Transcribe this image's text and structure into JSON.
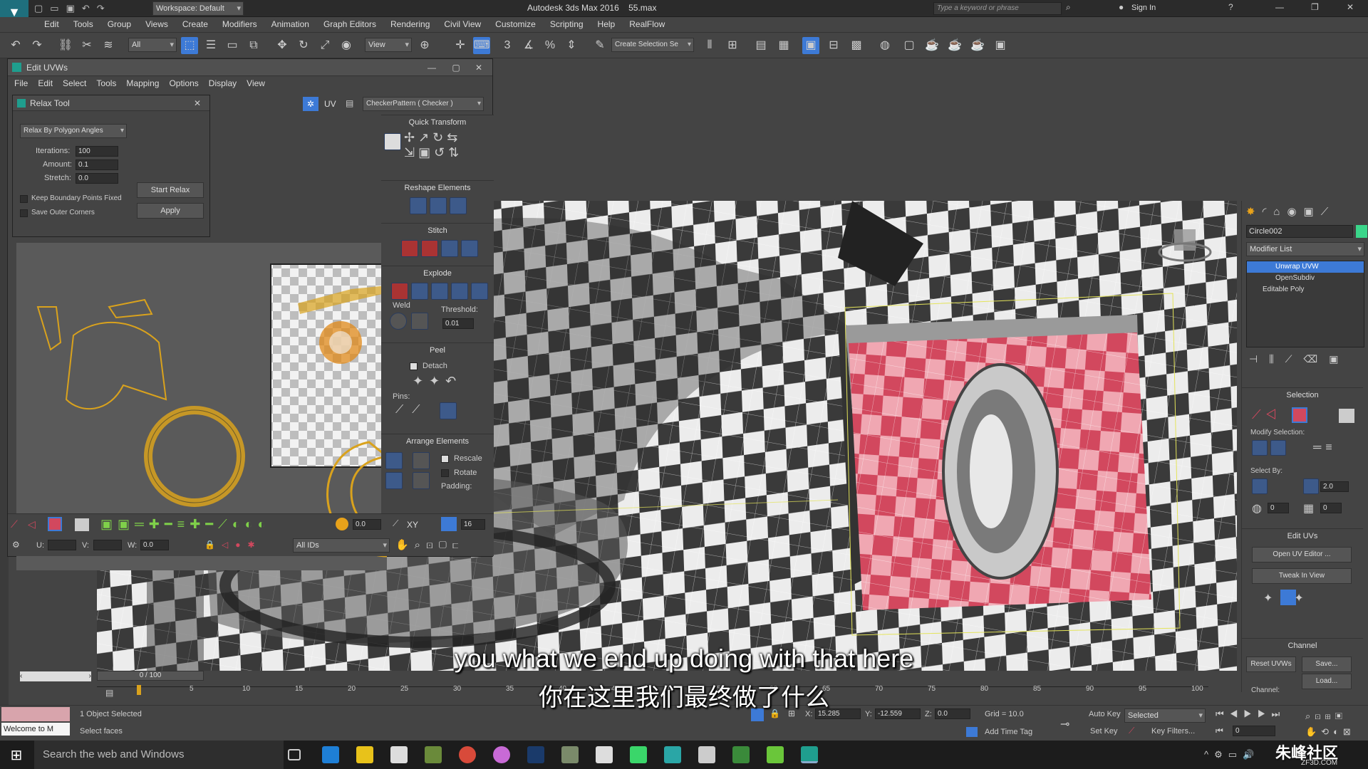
{
  "titlebar": {
    "workspace": "Workspace: Default",
    "app_title": "Autodesk 3ds Max 2016",
    "file": "55.max",
    "search_placeholder": "Type a keyword or phrase",
    "sign_in": "Sign In"
  },
  "menu": [
    "Edit",
    "Tools",
    "Group",
    "Views",
    "Create",
    "Modifiers",
    "Animation",
    "Graph Editors",
    "Rendering",
    "Civil View",
    "Customize",
    "Scripting",
    "Help",
    "RealFlow"
  ],
  "main_toolbar": {
    "filter": "All",
    "view": "View",
    "selection_set": "Create Selection Se"
  },
  "uv_editor": {
    "title": "Edit UVWs",
    "menu": [
      "File",
      "Edit",
      "Select",
      "Tools",
      "Mapping",
      "Options",
      "Display",
      "View"
    ],
    "uv_label": "UV",
    "texture": "CheckerPattern  ( Checker )",
    "all_ids": "All IDs"
  },
  "relax_tool": {
    "title": "Relax Tool",
    "method": "Relax By Polygon Angles",
    "iterations_label": "Iterations:",
    "iterations": "100",
    "amount_label": "Amount:",
    "amount": "0.1",
    "stretch_label": "Stretch:",
    "stretch": "0.0",
    "keep_boundary": "Keep Boundary Points Fixed",
    "save_outer": "Save Outer Corners",
    "start_relax": "Start Relax",
    "apply": "Apply"
  },
  "uv_panel": {
    "quick_transform": "Quick Transform",
    "reshape_elements": "Reshape Elements",
    "stitch": "Stitch",
    "explode": "Explode",
    "weld": "Weld",
    "threshold_label": "Threshold:",
    "threshold": "0.01",
    "peel": "Peel",
    "detach": "Detach",
    "pins": "Pins:",
    "arrange_elements": "Arrange Elements",
    "rescale": "Rescale",
    "rotate": "Rotate",
    "padding": "Padding:"
  },
  "uv_bottom": {
    "value1": "0.0",
    "xy": "XY",
    "value2": "16",
    "u_label": "U:",
    "v_label": "V:",
    "w_label": "W:",
    "w_value": "0.0"
  },
  "command_panel": {
    "object_name": "Circle002",
    "modifier_list": "Modifier List",
    "stack": [
      "Unwrap UVW",
      "OpenSubdiv",
      "Editable Poly"
    ],
    "selection": "Selection",
    "modify_selection": "Modify Selection:",
    "select_by": "Select By:",
    "angle": "2.0",
    "select_by_value1": "0",
    "select_by_value2": "0",
    "edit_uvs": "Edit UVs",
    "open_uv_editor": "Open UV Editor ...",
    "tweak_in_view": "Tweak In View",
    "channel": "Channel",
    "reset_uvws": "Reset UVWs",
    "save": "Save...",
    "load": "Load...",
    "channel_label": "Channel:"
  },
  "timeline": {
    "frame": "0 / 100",
    "ticks": [
      "0",
      "5",
      "10",
      "15",
      "20",
      "25",
      "30",
      "35",
      "40",
      "45",
      "50",
      "55",
      "60",
      "65",
      "70",
      "75",
      "80",
      "85",
      "90",
      "95",
      "100"
    ]
  },
  "status": {
    "objects": "1 Object Selected",
    "prompt": "Select faces",
    "welcome": "Welcome to M",
    "x_label": "X:",
    "x": "15.285",
    "y_label": "Y:",
    "y": "-12.559",
    "z_label": "Z:",
    "z": "0.0",
    "grid": "Grid = 10.0",
    "auto_key": "Auto Key",
    "set_key": "Set Key",
    "selected": "Selected",
    "key_filters": "Key Filters...",
    "add_time_tag": "Add Time Tag",
    "frame_field": "0"
  },
  "subtitles": {
    "en": "you what we end up doing with that here",
    "zh": "你在这里我们最终做了什么"
  },
  "taskbar": {
    "search": "Search the web and Windows",
    "watermark": "朱峰社区",
    "watermark_sub": "ZF3D.COM"
  },
  "colors": {
    "selected_face": "#d2485e",
    "uv_wire": "#d9a21d",
    "accent": "#3d7ad6"
  }
}
